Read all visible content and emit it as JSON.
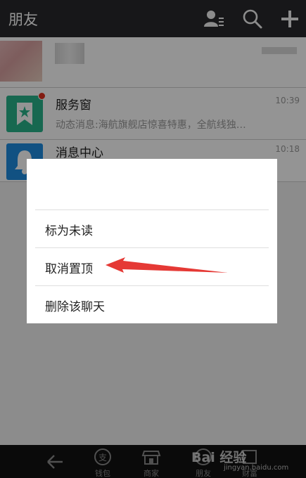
{
  "header": {
    "title": "朋友",
    "icons": [
      "contacts-list-icon",
      "search-icon",
      "plus-icon"
    ]
  },
  "conversations": [
    {
      "name": "服务窗",
      "message": "动态消息:海航旗舰店惊喜特惠，全航线独…",
      "time": "10:39",
      "icon": "service-window-icon",
      "unread_dot": true
    },
    {
      "name": "消息中心",
      "message": "",
      "time": "10:18",
      "icon": "bell-icon",
      "unread_dot": false
    }
  ],
  "dialog": {
    "title": "",
    "items": [
      "标为未读",
      "取消置顶",
      "删除该聊天"
    ]
  },
  "bottom_nav": {
    "items": [
      "钱包",
      "商家",
      "朋友",
      "财富"
    ]
  },
  "watermark": {
    "main": "Bai 经验",
    "sub": "jingyan.baidu.com"
  },
  "colors": {
    "header_bg": "#28292b",
    "service_green": "#29b48b",
    "bell_blue": "#1e8ce0",
    "annotation_red": "#e53935"
  }
}
